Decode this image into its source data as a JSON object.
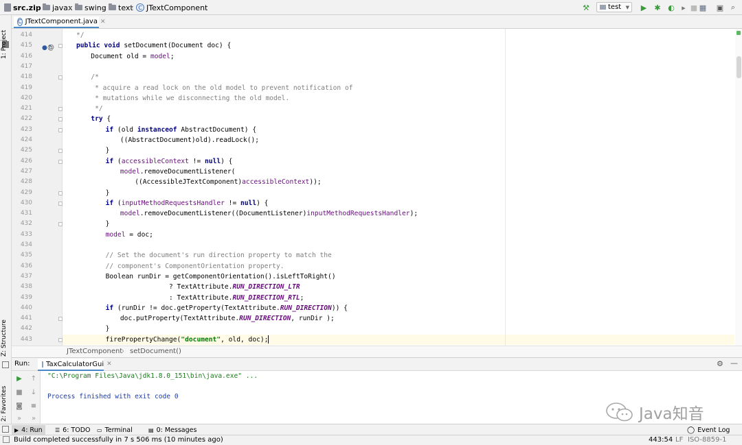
{
  "navbar": {
    "breadcrumb": [
      "src.zip",
      "javax",
      "swing",
      "text",
      "JTextComponent"
    ],
    "run_config": "test"
  },
  "side_tabs": {
    "project": "1: Project",
    "structure": "Z: Structure",
    "favorites": "2: Favorites"
  },
  "editor": {
    "tab_label": "JTextComponent.java",
    "lines": [
      {
        "n": "414",
        "segs": [
          {
            "t": "*/",
            "c": "cmt"
          }
        ],
        "ind": 1
      },
      {
        "n": "415",
        "segs": [
          {
            "t": "public void ",
            "c": "kw"
          },
          {
            "t": "setDocument(Document doc) {",
            "c": ""
          }
        ],
        "ind": 1
      },
      {
        "n": "416",
        "segs": [
          {
            "t": "Document old = ",
            "c": ""
          },
          {
            "t": "model",
            "c": "fld"
          },
          {
            "t": ";",
            "c": ""
          }
        ],
        "ind": 2
      },
      {
        "n": "417",
        "segs": [],
        "ind": 0
      },
      {
        "n": "418",
        "segs": [
          {
            "t": "/*",
            "c": "cmt"
          }
        ],
        "ind": 2
      },
      {
        "n": "419",
        "segs": [
          {
            "t": " * acquire a read lock on the old model to prevent notification of",
            "c": "cmt"
          }
        ],
        "ind": 2
      },
      {
        "n": "420",
        "segs": [
          {
            "t": " * mutations while we disconnecting the old model.",
            "c": "cmt"
          }
        ],
        "ind": 2
      },
      {
        "n": "421",
        "segs": [
          {
            "t": " */",
            "c": "cmt"
          }
        ],
        "ind": 2
      },
      {
        "n": "422",
        "segs": [
          {
            "t": "try ",
            "c": "kw"
          },
          {
            "t": "{",
            "c": ""
          }
        ],
        "ind": 2
      },
      {
        "n": "423",
        "segs": [
          {
            "t": "if ",
            "c": "kw"
          },
          {
            "t": "(old ",
            "c": ""
          },
          {
            "t": "instanceof ",
            "c": "kw"
          },
          {
            "t": "AbstractDocument) {",
            "c": ""
          }
        ],
        "ind": 3
      },
      {
        "n": "424",
        "segs": [
          {
            "t": "((AbstractDocument)old).readLock();",
            "c": ""
          }
        ],
        "ind": 4
      },
      {
        "n": "425",
        "segs": [
          {
            "t": "}",
            "c": ""
          }
        ],
        "ind": 3
      },
      {
        "n": "426",
        "segs": [
          {
            "t": "if ",
            "c": "kw"
          },
          {
            "t": "(",
            "c": ""
          },
          {
            "t": "accessibleContext",
            "c": "fld"
          },
          {
            "t": " != ",
            "c": ""
          },
          {
            "t": "null",
            "c": "kw"
          },
          {
            "t": ") {",
            "c": ""
          }
        ],
        "ind": 3
      },
      {
        "n": "427",
        "segs": [
          {
            "t": "model",
            "c": "fld"
          },
          {
            "t": ".removeDocumentListener(",
            "c": ""
          }
        ],
        "ind": 4
      },
      {
        "n": "428",
        "segs": [
          {
            "t": "((AccessibleJTextComponent)",
            "c": ""
          },
          {
            "t": "accessibleContext",
            "c": "fld"
          },
          {
            "t": "));",
            "c": ""
          }
        ],
        "ind": 5
      },
      {
        "n": "429",
        "segs": [
          {
            "t": "}",
            "c": ""
          }
        ],
        "ind": 3
      },
      {
        "n": "430",
        "segs": [
          {
            "t": "if ",
            "c": "kw"
          },
          {
            "t": "(",
            "c": ""
          },
          {
            "t": "inputMethodRequestsHandler",
            "c": "fld"
          },
          {
            "t": " != ",
            "c": ""
          },
          {
            "t": "null",
            "c": "kw"
          },
          {
            "t": ") {",
            "c": ""
          }
        ],
        "ind": 3
      },
      {
        "n": "431",
        "segs": [
          {
            "t": "model",
            "c": "fld"
          },
          {
            "t": ".removeDocumentListener((DocumentListener)",
            "c": ""
          },
          {
            "t": "inputMethodRequestsHandler",
            "c": "fld"
          },
          {
            "t": ");",
            "c": ""
          }
        ],
        "ind": 4
      },
      {
        "n": "432",
        "segs": [
          {
            "t": "}",
            "c": ""
          }
        ],
        "ind": 3
      },
      {
        "n": "433",
        "segs": [
          {
            "t": "model",
            "c": "fld"
          },
          {
            "t": " = doc;",
            "c": ""
          }
        ],
        "ind": 3
      },
      {
        "n": "434",
        "segs": [],
        "ind": 0
      },
      {
        "n": "435",
        "segs": [
          {
            "t": "// Set the document's run direction property to match the",
            "c": "cmt"
          }
        ],
        "ind": 3
      },
      {
        "n": "436",
        "segs": [
          {
            "t": "// component's ComponentOrientation property.",
            "c": "cmt"
          }
        ],
        "ind": 3
      },
      {
        "n": "437",
        "segs": [
          {
            "t": "Boolean runDir = getComponentOrientation().isLeftToRight()",
            "c": ""
          }
        ],
        "ind": 3
      },
      {
        "n": "438",
        "segs": [
          {
            "t": "                ? TextAttribute.",
            "c": ""
          },
          {
            "t": "RUN_DIRECTION_LTR",
            "c": "sfld"
          }
        ],
        "ind": 3
      },
      {
        "n": "439",
        "segs": [
          {
            "t": "                : TextAttribute.",
            "c": ""
          },
          {
            "t": "RUN_DIRECTION_RTL",
            "c": "sfld"
          },
          {
            "t": ";",
            "c": ""
          }
        ],
        "ind": 3
      },
      {
        "n": "440",
        "segs": [
          {
            "t": "if ",
            "c": "kw"
          },
          {
            "t": "(runDir != doc.getProperty(TextAttribute.",
            "c": ""
          },
          {
            "t": "RUN_DIRECTION",
            "c": "sfld"
          },
          {
            "t": ")) {",
            "c": ""
          }
        ],
        "ind": 3
      },
      {
        "n": "441",
        "segs": [
          {
            "t": "doc.putProperty(TextAttribute.",
            "c": ""
          },
          {
            "t": "RUN_DIRECTION",
            "c": "sfld"
          },
          {
            "t": ", runDir );",
            "c": ""
          }
        ],
        "ind": 4
      },
      {
        "n": "442",
        "segs": [
          {
            "t": "}",
            "c": ""
          }
        ],
        "ind": 3
      },
      {
        "n": "443",
        "segs": [
          {
            "t": "firePropertyChange(",
            "c": ""
          },
          {
            "t": "\"document\"",
            "c": "str"
          },
          {
            "t": ", old, doc);",
            "c": ""
          }
        ],
        "ind": 3
      }
    ],
    "code_breadcrumb": [
      "JTextComponent",
      "setDocument()"
    ]
  },
  "run_panel": {
    "label": "Run:",
    "tab_label": "TaxCalculatorGui",
    "console": [
      {
        "text": "\"C:\\Program Files\\Java\\jdk1.8.0_151\\bin\\java.exe\" ...",
        "color": "#1b7b1b"
      },
      {
        "text": "",
        "color": "#000"
      },
      {
        "text": "Process finished with exit code 0",
        "color": "#1c3aa9"
      }
    ]
  },
  "bottom_tabs": [
    {
      "label": "4: Run",
      "icon": "run-icon",
      "active": true
    },
    {
      "label": "6: TODO",
      "icon": "todo-icon",
      "active": false
    },
    {
      "label": "Terminal",
      "icon": "terminal-icon",
      "active": false
    },
    {
      "label": "0: Messages",
      "icon": "messages-icon",
      "active": false
    }
  ],
  "event_log": "Event Log",
  "status": {
    "message": "Build completed successfully in 7 s 506 ms (10 minutes ago)",
    "position": "443:54",
    "line_sep": "LF",
    "encoding": "ISO-8859-1"
  },
  "watermark": "Java知音",
  "colors": {
    "accent": "#4a88c7",
    "run_green": "#3a9a3a",
    "string": "#008000",
    "keyword": "#000080",
    "field": "#660e7a"
  }
}
